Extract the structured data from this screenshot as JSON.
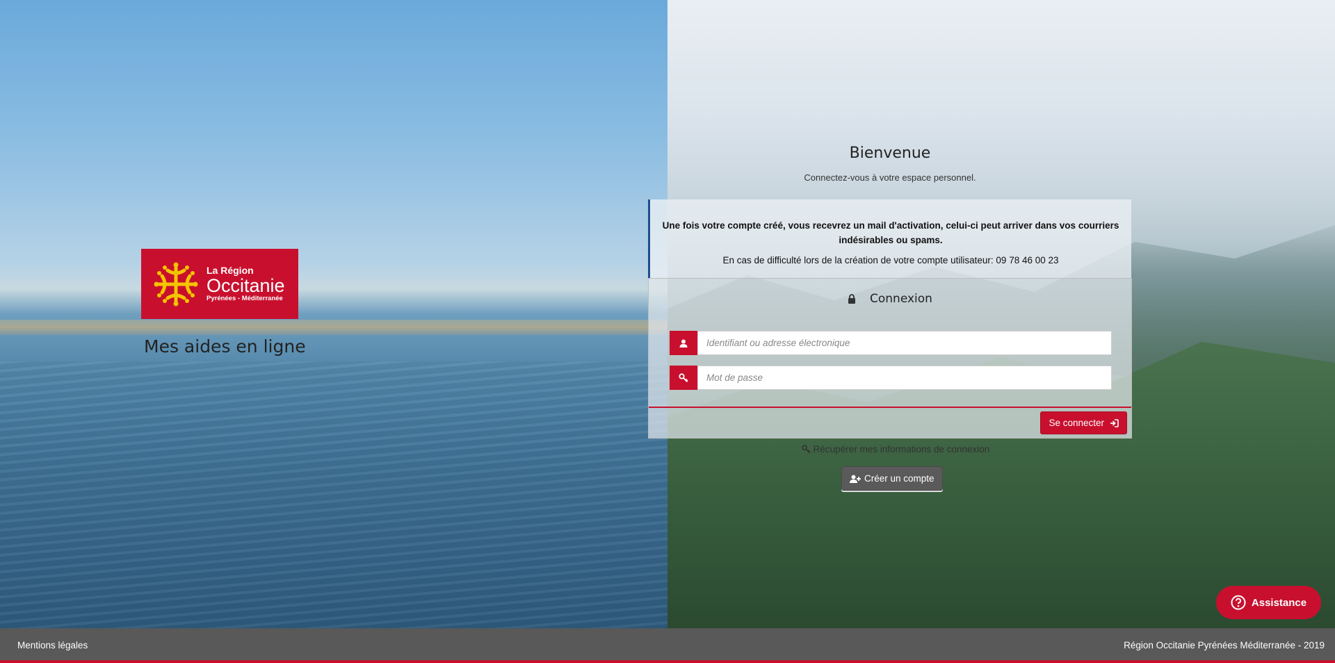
{
  "logo": {
    "line1": "La Région",
    "line2": "Occitanie",
    "line3": "Pyrénées - Méditerranée"
  },
  "app_title": "Mes aides en ligne",
  "welcome": {
    "title": "Bienvenue",
    "subtitle": "Connectez-vous à votre espace personnel."
  },
  "info": {
    "bold": "Une fois votre compte créé, vous recevrez un mail d'activation, celui-ci peut arriver dans vos courriers indésirables ou spams.",
    "normal": "En cas de difficulté lors de la création de votre compte utilisateur: 09 78 46 00 23"
  },
  "login": {
    "heading": "Connexion",
    "username_placeholder": "Identifiant ou adresse électronique",
    "password_placeholder": "Mot de passe",
    "submit_label": "Se connecter"
  },
  "recover_label": "Récupérer mes informations de connexion",
  "create_account_label": "Créer un compte",
  "assistance_label": "Assistance",
  "footer": {
    "left": "Mentions légales",
    "right": "Région Occitanie Pyrénées Méditerranée - 2019"
  },
  "colors": {
    "brand_red": "#c8102e",
    "footer_gray": "#595959",
    "info_border": "#1f4e8c"
  },
  "icons": [
    "lock-icon",
    "user-icon",
    "key-icon",
    "sign-in-icon",
    "user-plus-icon",
    "question-circle-icon",
    "occitan-cross-icon"
  ]
}
